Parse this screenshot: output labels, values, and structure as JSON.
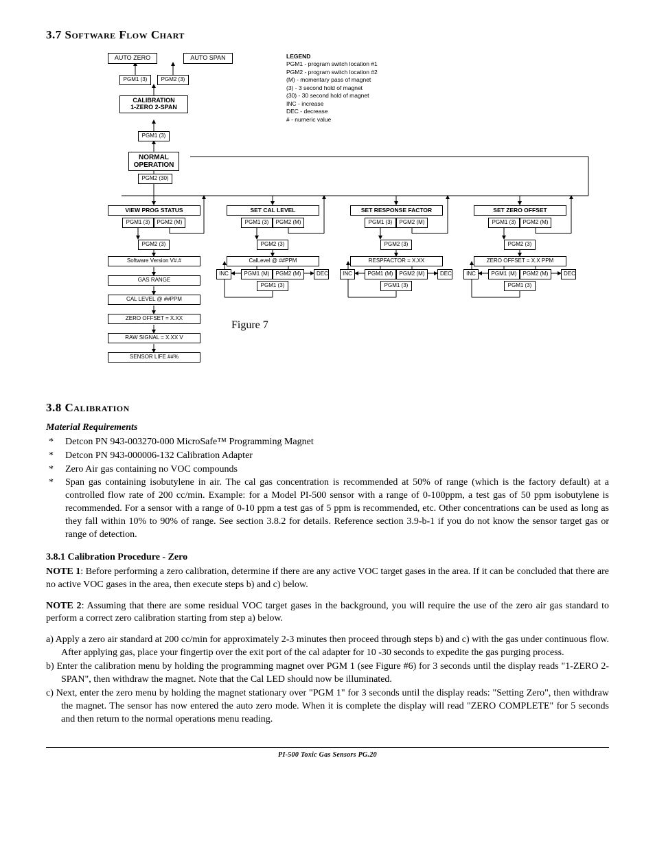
{
  "headings": {
    "h37": "3.7  Software Flow Chart",
    "h38": "3.8  Calibration",
    "matreq": "Material Requirements",
    "h381": "3.8.1  Calibration Procedure - Zero"
  },
  "footer": "PI-500 Toxic Gas Sensors   PG.20",
  "figure_caption": "Figure 7",
  "legend": {
    "title": "LEGEND",
    "lines": [
      "PGM1 - program switch location #1",
      "PGM2 - program switch location #2",
      "(M) - momentary pass of magnet",
      "(3) - 3 second hold of magnet",
      "(30) - 30 second hold of magnet",
      "INC - increase",
      "DEC - decrease",
      "# - numeric value"
    ]
  },
  "flow": {
    "auto_zero": "AUTO ZERO",
    "auto_span": "AUTO SPAN",
    "pgm1_3": "PGM1 (3)",
    "pgm2_3": "PGM2 (3)",
    "pgm2_30": "PGM2 (30)",
    "pgm1_m": "PGM1 (M)",
    "pgm2_m": "PGM2 (M)",
    "calibration": "CALIBRATION\n1-ZERO 2-SPAN",
    "normal": "NORMAL\nOPERATION",
    "inc": "INC",
    "dec": "DEC",
    "cols": {
      "view": {
        "title": "VIEW PROG STATUS",
        "items": [
          "Software Version V#.#",
          "GAS  RANGE",
          "CAL LEVEL @ ##PPM",
          "ZERO OFFSET = X.XX",
          "RAW SIGNAL = X.XX V",
          "SENSOR LIFE ##%"
        ]
      },
      "cal": {
        "title": "SET CAL LEVEL",
        "value": "CalLevel @ ##PPM"
      },
      "resp": {
        "title": "SET RESPONSE FACTOR",
        "value": "RESPFACTOR = X.XX"
      },
      "zero": {
        "title": "SET ZERO OFFSET",
        "value": "ZERO OFFSET = X.X PPM"
      }
    }
  },
  "materials": [
    "Detcon PN 943-003270-000 MicroSafe™ Programming Magnet",
    "Detcon PN 943-000006-132 Calibration Adapter",
    "Zero Air gas containing no VOC compounds",
    "Span gas containing isobutylene in air. The cal gas concentration is recommended at 50% of range (which is the factory default) at a controlled flow rate of 200 cc/min. Example: for a Model PI-500 sensor with a range of 0-100ppm, a test gas of 50 ppm isobutylene is recommended. For a sensor with a range of 0-10 ppm a test gas of 5 ppm is recommended, etc. Other concentrations can be used as long as they fall within 10% to 90% of range. See section 3.8.2 for details. Reference section 3.9-b-1 if you do not know the sensor target gas or range of detection."
  ],
  "notes": {
    "n1_label": "NOTE 1",
    "n1": ":  Before performing a zero calibration, determine if there are any active VOC target gases in the area.  If it can be concluded that there are no active VOC gases in the area, then execute steps b) and c) below.",
    "n2_label": "NOTE 2",
    "n2": ": Assuming that there are some residual VOC target gases in the background, you will require the use of the zero air gas standard to perform a correct zero calibration starting from step a) below."
  },
  "steps": {
    "a": "a) Apply a zero air standard at 200 cc/min for approximately 2-3 minutes then proceed through steps b) and c) with the gas under continuous flow.  After applying gas, place your fingertip over the exit port of the cal adapter for 10 -30 seconds to expedite the gas purging process.",
    "b": "b) Enter the calibration menu by holding the programming magnet over PGM 1 (see Figure #6) for 3 seconds until the display reads \"1-ZERO 2-SPAN\", then withdraw the magnet.  Note that the Cal LED should now be illuminated.",
    "c": "c) Next, enter the zero menu by holding the magnet stationary over \"PGM 1\" for 3 seconds until the display reads: \"Setting Zero\", then withdraw the magnet.  The sensor has now entered the auto zero mode.  When it is complete the display will read \"ZERO COMPLETE\" for 5 seconds and then return to the normal operations menu reading."
  }
}
